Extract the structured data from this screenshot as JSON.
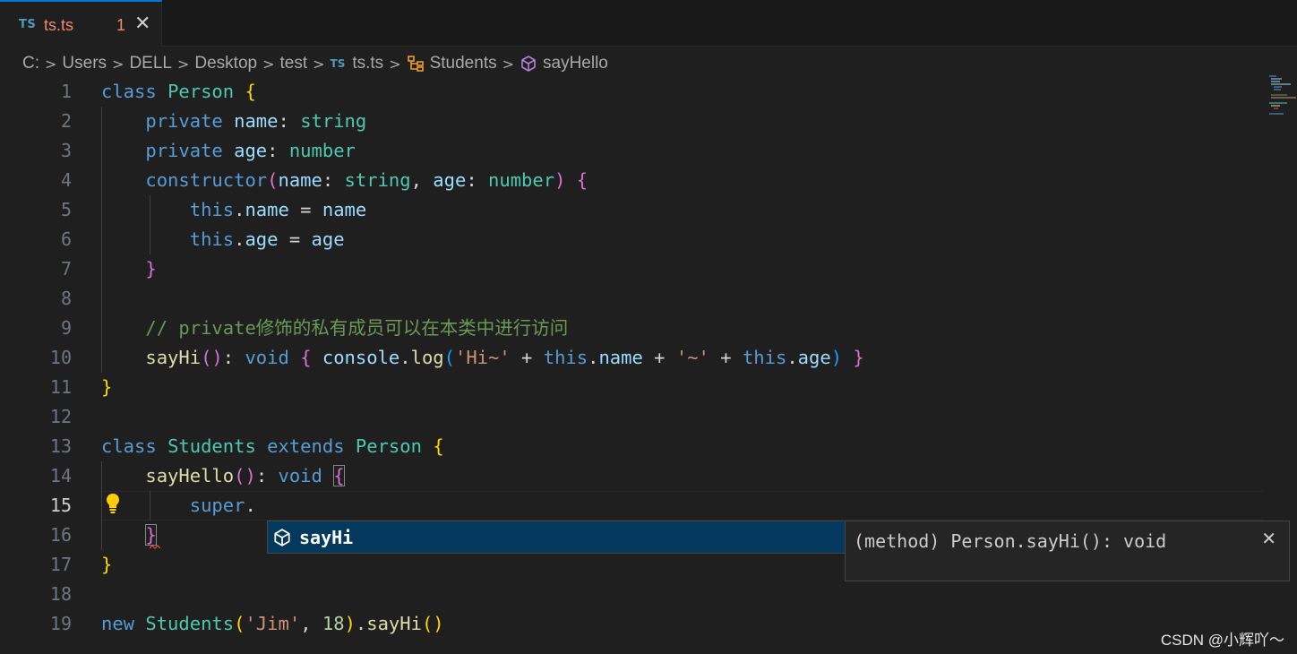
{
  "tab": {
    "badge": "TS",
    "filename": "ts.ts",
    "problem_count": "1",
    "close_glyph": "✕"
  },
  "breadcrumb": {
    "items": [
      "C:",
      "Users",
      "DELL",
      "Desktop",
      "test",
      "ts.ts",
      "Students",
      "sayHello"
    ],
    "file_badge": "TS",
    "separator": ">"
  },
  "editor": {
    "line_numbers": [
      "1",
      "2",
      "3",
      "4",
      "5",
      "6",
      "7",
      "8",
      "9",
      "10",
      "11",
      "12",
      "13",
      "14",
      "15",
      "16",
      "17",
      "18",
      "19"
    ],
    "active_line": "15",
    "tokens": {
      "class": "class",
      "person": "Person",
      "private": "private",
      "name": "name",
      "age": "age",
      "string": "string",
      "number": "number",
      "constructor": "constructor",
      "this": "this",
      "comment": "// private修饰的私有成员可以在本类中进行访问",
      "sayHi": "sayHi",
      "void": "void",
      "console": "console",
      "log": "log",
      "str_hi": "'Hi~'",
      "str_tilde": "'~'",
      "students": "Students",
      "extends": "extends",
      "sayHello": "sayHello",
      "super": "super",
      "new": "new",
      "str_jim": "'Jim'",
      "num_18": "18"
    }
  },
  "suggest": {
    "item_label": "sayHi",
    "item_icon": "method-cube-icon",
    "details_text": "(method) Person.sayHi(): void",
    "details_close": "✕"
  },
  "watermark": "CSDN @小辉吖～",
  "colors": {
    "background": "#1f1f1f",
    "keyword": "#569cd6",
    "type": "#4ec9b0",
    "variable": "#9cdcfe",
    "function": "#dcdcaa",
    "string": "#ce9178",
    "comment": "#6a9955",
    "suggest_selected": "#04395e"
  }
}
